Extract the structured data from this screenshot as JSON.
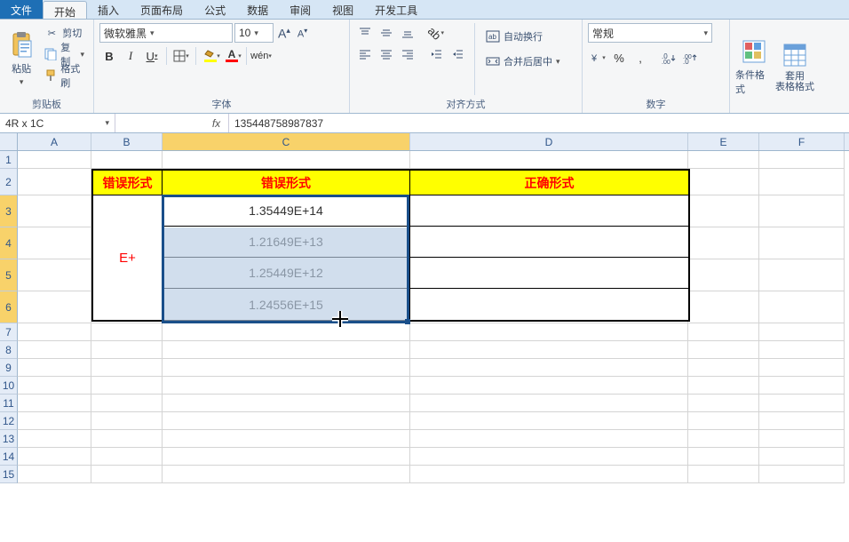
{
  "menu": {
    "file": "文件",
    "tabs": [
      "开始",
      "插入",
      "页面布局",
      "公式",
      "数据",
      "审阅",
      "视图",
      "开发工具"
    ],
    "active_index": 0
  },
  "ribbon": {
    "clipboard": {
      "paste": "粘贴",
      "cut": "剪切",
      "copy": "复制",
      "format_painter": "格式刷",
      "label": "剪贴板"
    },
    "font": {
      "name": "微软雅黑",
      "size": "10",
      "inc_a": "A",
      "dec_a": "A",
      "bold": "B",
      "italic": "I",
      "underline": "U",
      "label": "字体"
    },
    "align": {
      "wrap": "自动换行",
      "merge": "合并后居中",
      "label": "对齐方式"
    },
    "number": {
      "format": "常规",
      "percent": "%",
      "comma": ",",
      "label": "数字"
    },
    "styles": {
      "cond": "条件格式",
      "table": "套用\n表格格式"
    }
  },
  "cell_ref": {
    "name": "4R x 1C",
    "fx": "fx",
    "formula": "135448758987837"
  },
  "columns": [
    "A",
    "B",
    "C",
    "D",
    "E",
    "F"
  ],
  "rows": [
    "1",
    "2",
    "3",
    "4",
    "5",
    "6",
    "7",
    "8",
    "9",
    "10",
    "11",
    "12",
    "13",
    "14",
    "15"
  ],
  "table": {
    "h1": "错误形式",
    "h2": "错误形式",
    "h3": "正确形式",
    "side": "E+",
    "c": [
      "1.35449E+14",
      "1.21649E+13",
      "1.25449E+12",
      "1.24556E+15"
    ]
  },
  "colors": {
    "accent": "#1a4f8a",
    "yellow": "#ffff00",
    "red": "#ff0000",
    "sel_fill": "#b8cce4"
  }
}
